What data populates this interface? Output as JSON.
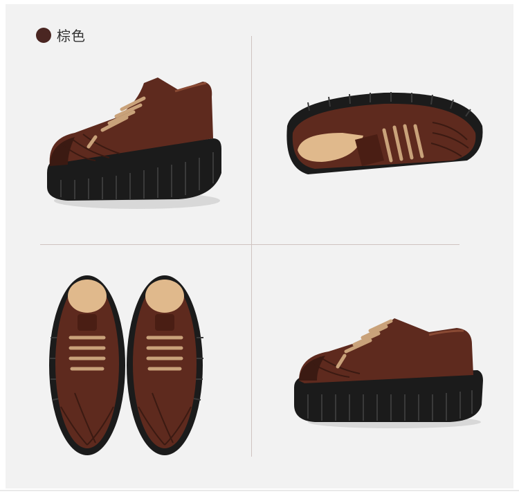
{
  "color_option": {
    "label": "棕色",
    "swatch_color": "#4a2622"
  },
  "colors": {
    "leather": "#5e2a1e",
    "leather_dark": "#3b1a12",
    "sole": "#1b1b1b",
    "lace": "#c9a27a",
    "lining": "#e0b98c"
  },
  "images": [
    {
      "view": "side-left"
    },
    {
      "view": "top-angle"
    },
    {
      "view": "front-pair"
    },
    {
      "view": "side-right"
    }
  ]
}
